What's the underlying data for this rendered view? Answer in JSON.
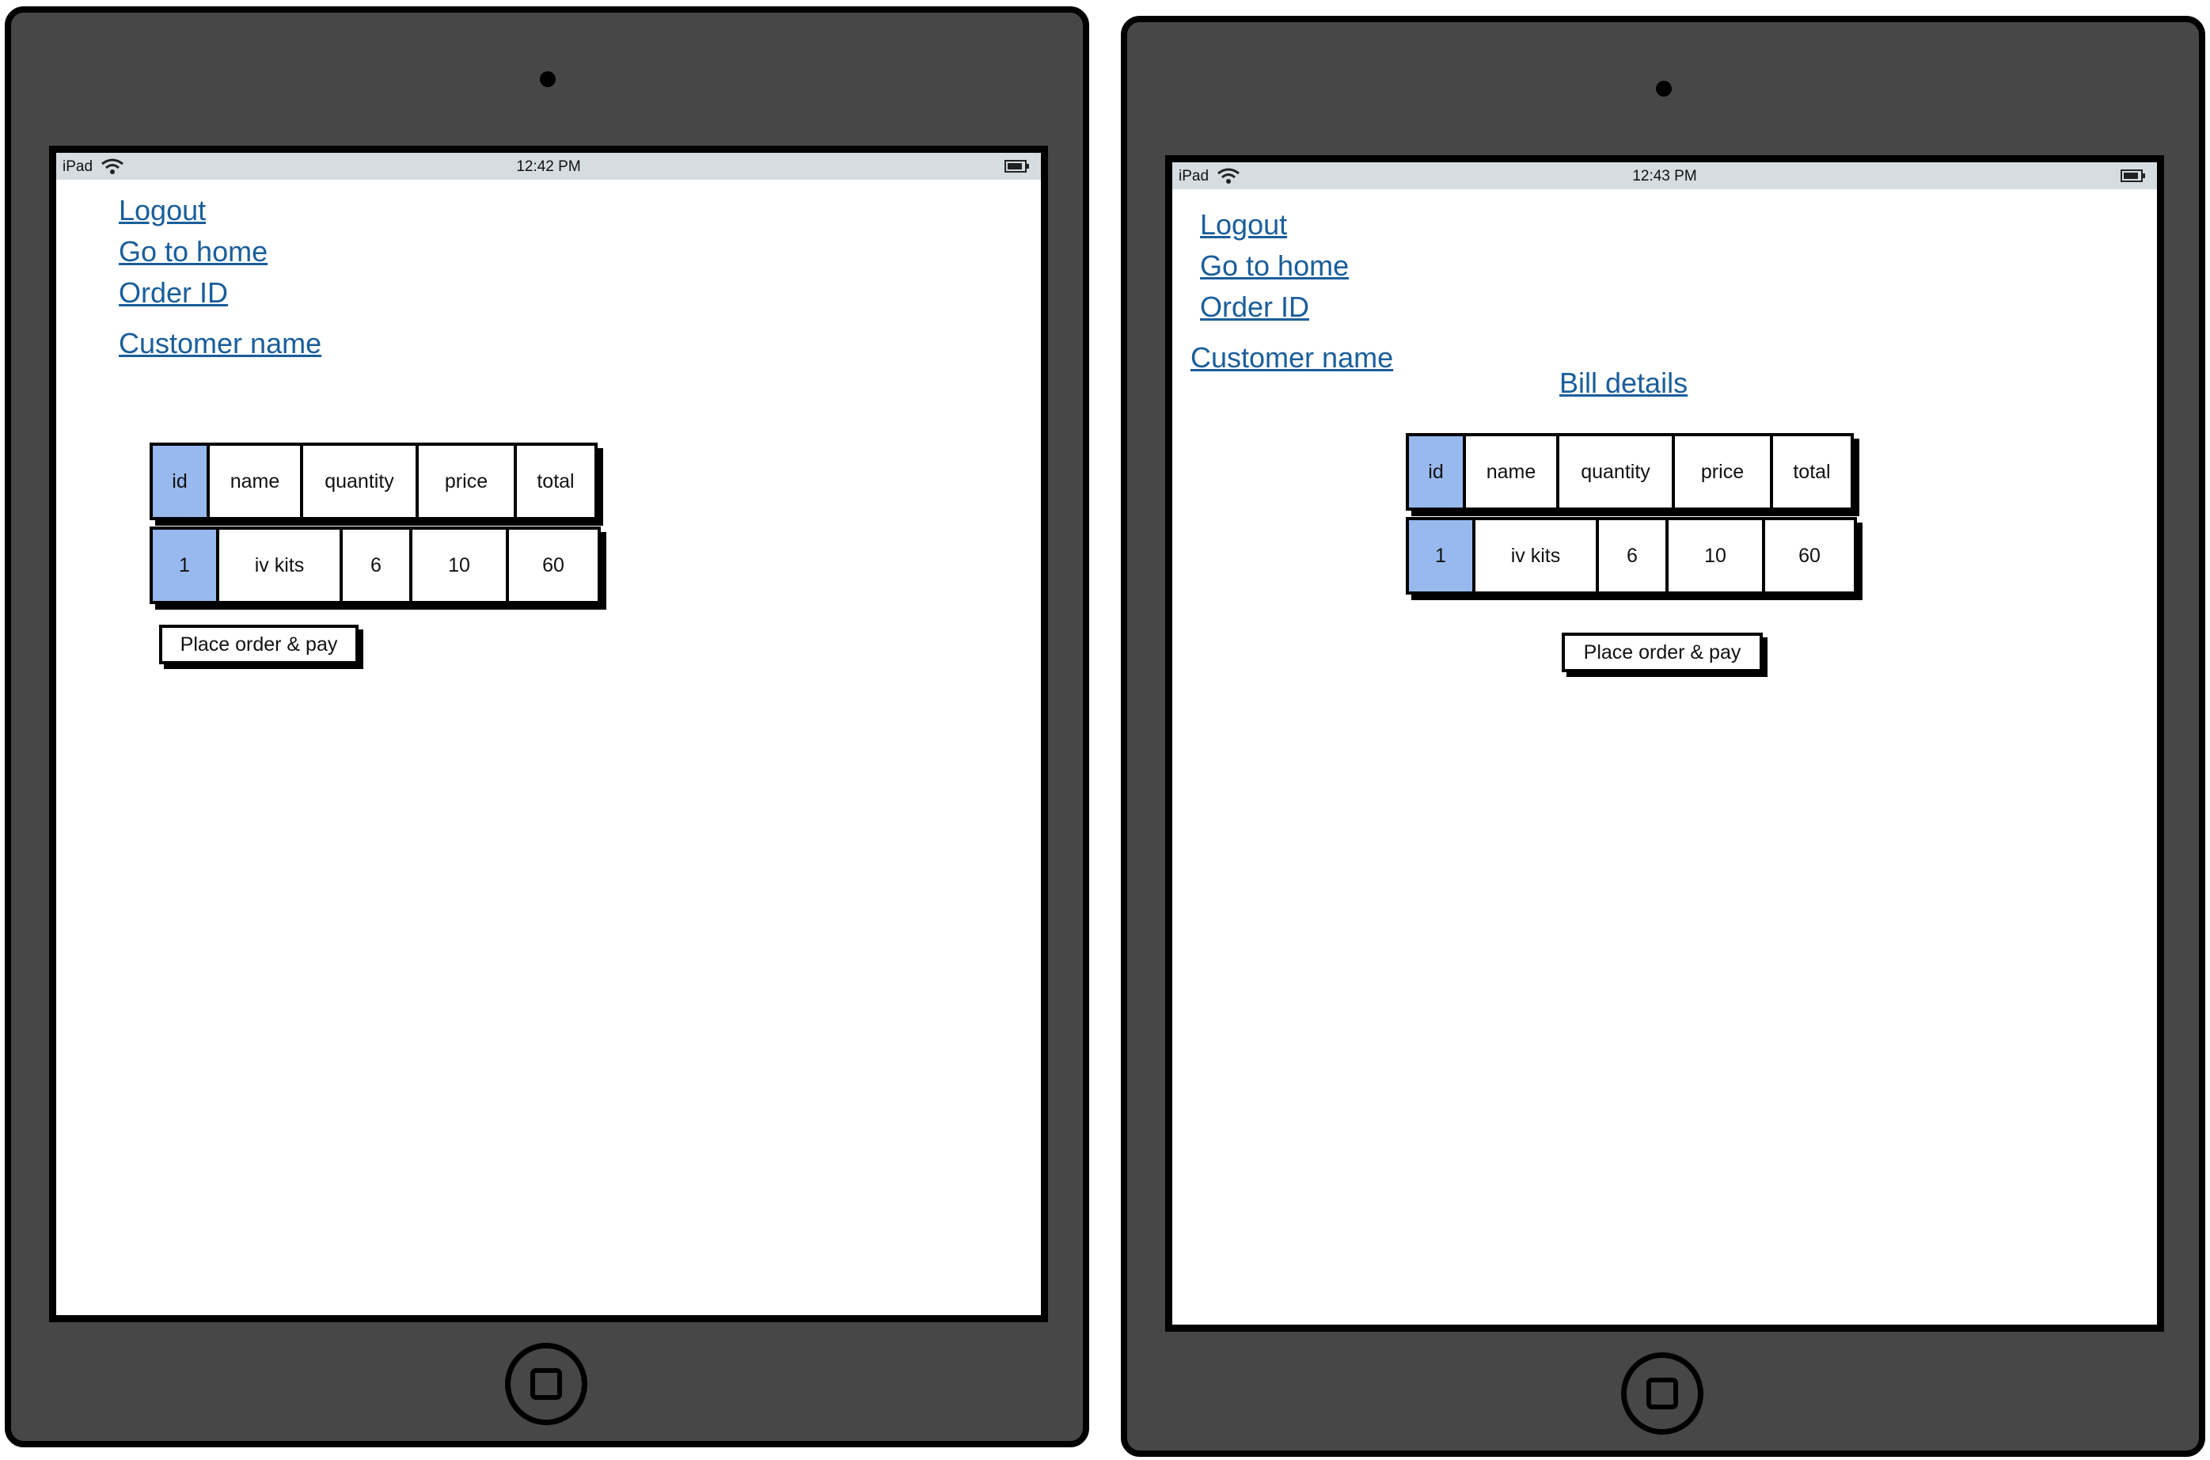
{
  "colors": {
    "device_body": "#474747",
    "status_bar": "#d6dde0",
    "link": "#1a5e9a",
    "highlight_cell": "#98b9ee"
  },
  "left": {
    "status": {
      "carrier": "iPad",
      "time": "12:42 PM"
    },
    "links": {
      "logout": "Logout",
      "go_home": "Go to home",
      "order_id": "Order ID",
      "customer_name": "Customer name"
    },
    "table": {
      "headers": [
        "id",
        "name",
        "quantity",
        "price",
        "total"
      ],
      "rows": [
        [
          "1",
          "iv kits",
          "6",
          "10",
          "60"
        ]
      ]
    },
    "button": "Place order & pay"
  },
  "right": {
    "status": {
      "carrier": "iPad",
      "time": "12:43 PM"
    },
    "links": {
      "logout": "Logout",
      "go_home": "Go to home",
      "order_id": "Order ID",
      "customer_name": "Customer name",
      "bill_details": "Bill details"
    },
    "table": {
      "headers": [
        "id",
        "name",
        "quantity",
        "price",
        "total"
      ],
      "rows": [
        [
          "1",
          "iv kits",
          "6",
          "10",
          "60"
        ]
      ]
    },
    "button": "Place order & pay"
  }
}
